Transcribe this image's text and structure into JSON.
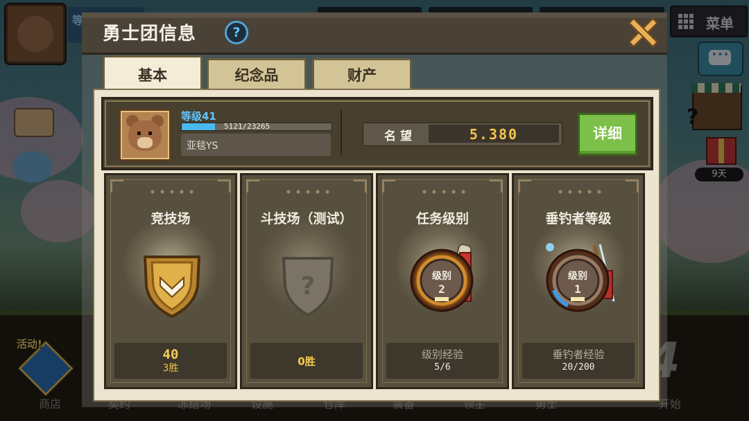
{
  "modal": {
    "title": "勇士团信息",
    "help_icon": "question-icon",
    "close_icon": "close-x-icon",
    "tabs": [
      {
        "label": "基本",
        "active": true
      },
      {
        "label": "纪念品",
        "active": false
      },
      {
        "label": "财产",
        "active": false
      }
    ]
  },
  "profile": {
    "level_label": "等级41",
    "xp_text": "5121/23265",
    "xp_fraction": 0.22,
    "guild_name": "亚毯YS",
    "reputation_label": "名望",
    "reputation_value": "5.380",
    "detail_button": "详细"
  },
  "cards": [
    {
      "title": "竞技场",
      "icon": "gold-shield-icon",
      "value": "40",
      "sub": "3胜"
    },
    {
      "title": "斗技场（测试）",
      "icon": "locked-shield-question-icon",
      "value": "0胜"
    },
    {
      "title": "任务级别",
      "icon": "quest-level-badge-icon",
      "badge_label": "级别",
      "badge_value": "2",
      "stat_label": "级别经验",
      "stat_value": "5/6"
    },
    {
      "title": "垂钓者等级",
      "icon": "angler-level-badge-icon",
      "badge_label": "级别",
      "badge_value": "1",
      "stat_label": "垂钓者经验",
      "stat_value": "20/200"
    }
  ],
  "hud": {
    "menu_label": "菜单",
    "timer": "9天",
    "event_label": "活动!",
    "bottom_nav": [
      "商店",
      "契约",
      "冻结场",
      "设施",
      "仓库",
      "装备",
      "领主",
      "勇士",
      "开始"
    ],
    "colors": {
      "accent_gold": "#f4c64c",
      "level_blue": "#5fc6ff",
      "detail_green": "#7cc04a"
    }
  }
}
